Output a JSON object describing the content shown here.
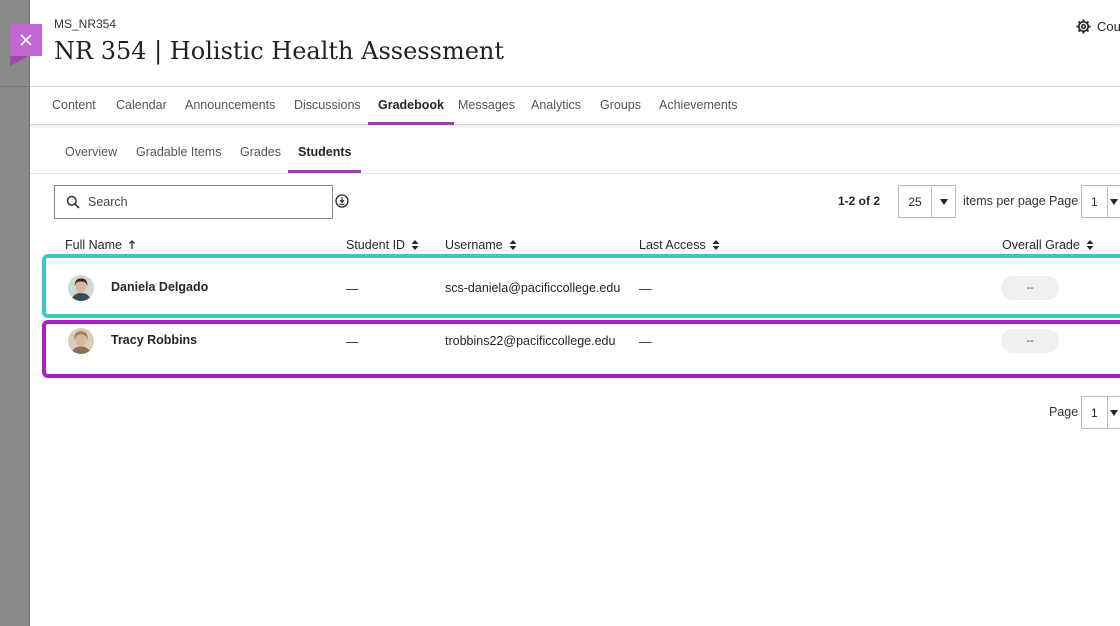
{
  "header": {
    "course_code": "MS_NR354",
    "course_title": "NR 354 | Holistic Health Assessment",
    "settings_label": "Cou"
  },
  "nav": {
    "tabs": [
      {
        "label": "Content"
      },
      {
        "label": "Calendar"
      },
      {
        "label": "Announcements"
      },
      {
        "label": "Discussions"
      },
      {
        "label": "Gradebook",
        "active": true
      },
      {
        "label": "Messages"
      },
      {
        "label": "Analytics"
      },
      {
        "label": "Groups"
      },
      {
        "label": "Achievements"
      }
    ]
  },
  "gradebook": {
    "tabs": [
      {
        "label": "Overview"
      },
      {
        "label": "Gradable Items"
      },
      {
        "label": "Grades"
      },
      {
        "label": "Students",
        "active": true
      }
    ]
  },
  "toolbar": {
    "search_placeholder": "Search",
    "search_value": "",
    "range_text": "1-2 of 2",
    "per_page_value": "25",
    "items_per_page_label": "items per page",
    "page_label": "Page",
    "page_value": "1"
  },
  "table": {
    "columns": [
      "Full Name",
      "Student ID",
      "Username",
      "Last Access",
      "Overall Grade"
    ],
    "rows": [
      {
        "name": "Daniela Delgado",
        "student_id": "—",
        "username": "scs-daniela@pacificcollege.edu",
        "last_access": "—",
        "grade": "--"
      },
      {
        "name": "Tracy Robbins",
        "student_id": "—",
        "username": "trobbins22@pacificcollege.edu",
        "last_access": "—",
        "grade": "--"
      }
    ]
  },
  "footer": {
    "page_label": "Page",
    "page_value": "1"
  },
  "colors": {
    "accent": "#9b3fb0",
    "close_button": "#c266d1",
    "highlight_teal": "#3cc7c9",
    "highlight_purple": "#a81ec4"
  }
}
